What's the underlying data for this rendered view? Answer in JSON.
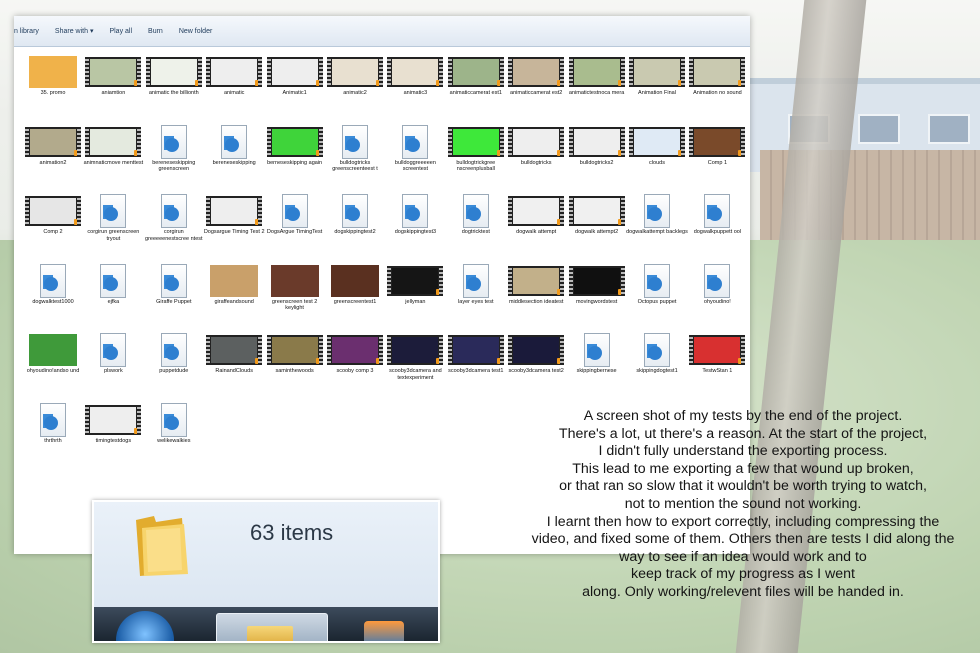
{
  "toolbar": {
    "library_label": "n library",
    "share_label": "Share with",
    "play_label": "Play all",
    "burn_label": "Burn",
    "new_folder_label": "New folder"
  },
  "files": [
    {
      "name": "35. promo",
      "kind": "picture",
      "tint": "#f0b24a"
    },
    {
      "name": "aniamtion",
      "kind": "video",
      "tint": "#b9c6a4"
    },
    {
      "name": "animatic the billionth",
      "kind": "video",
      "tint": "#eef2ea"
    },
    {
      "name": "animatic",
      "kind": "video",
      "tint": "#eeeeee"
    },
    {
      "name": "Animatic1",
      "kind": "video",
      "tint": "#eeeeee"
    },
    {
      "name": "animatic2",
      "kind": "video",
      "tint": "#e8e0d0"
    },
    {
      "name": "animatic3",
      "kind": "video",
      "tint": "#e8e0d0"
    },
    {
      "name": "animaticcamerat est1",
      "kind": "video",
      "tint": "#9db48a"
    },
    {
      "name": "animaticcamerat est2",
      "kind": "video",
      "tint": "#c7b59a"
    },
    {
      "name": "animatictestnoca mera",
      "kind": "video",
      "tint": "#a9bc8e"
    },
    {
      "name": "Animation Final",
      "kind": "video",
      "tint": "#c9c9b0"
    },
    {
      "name": "Animation no sound",
      "kind": "video",
      "tint": "#c9c9b0"
    },
    {
      "name": "animation2",
      "kind": "video",
      "tint": "#b2aa8c"
    },
    {
      "name": "animnaticmove menttest",
      "kind": "video",
      "tint": "#e4eadf"
    },
    {
      "name": "bereneseskipping greenscreen",
      "kind": "doc"
    },
    {
      "name": "bereneseskipping",
      "kind": "doc"
    },
    {
      "name": "berneseskipping again",
      "kind": "video",
      "tint": "#3fd43a"
    },
    {
      "name": "bulldogtricks greenscreenteest t",
      "kind": "doc"
    },
    {
      "name": "bulldoggreeeeen screentest",
      "kind": "doc"
    },
    {
      "name": "bulldogtrickgree nscreenplusball",
      "kind": "video",
      "tint": "#3ee83a"
    },
    {
      "name": "bulldogtricks",
      "kind": "video",
      "tint": "#eeeeee"
    },
    {
      "name": "bulldogtricks2",
      "kind": "video",
      "tint": "#eeeeee"
    },
    {
      "name": "clouds",
      "kind": "video",
      "tint": "#dfeaf5"
    },
    {
      "name": "Comp 1",
      "kind": "video",
      "tint": "#7a4a2a"
    },
    {
      "name": "Comp 2",
      "kind": "video",
      "tint": "#e6e6e6"
    },
    {
      "name": "corgirun greenscreen tryout",
      "kind": "doc"
    },
    {
      "name": "corgirun greeeeenestscree ntest",
      "kind": "doc"
    },
    {
      "name": "Dogsargue Timing Test 2",
      "kind": "video",
      "tint": "#eeeeee"
    },
    {
      "name": "DogsArgue TimingTest",
      "kind": "doc"
    },
    {
      "name": "dogskippingtest2",
      "kind": "doc"
    },
    {
      "name": "dogskippingtest3",
      "kind": "doc"
    },
    {
      "name": "dogtricktest",
      "kind": "doc"
    },
    {
      "name": "dogwalk attempt",
      "kind": "video",
      "tint": "#f0f0f0"
    },
    {
      "name": "dogwalk attempt2",
      "kind": "video",
      "tint": "#f0f0f0"
    },
    {
      "name": "dogwalkattempt backlegs",
      "kind": "doc"
    },
    {
      "name": "dogwalkpuppett ool",
      "kind": "doc"
    },
    {
      "name": "dogwalktest1000",
      "kind": "doc"
    },
    {
      "name": "ejfka",
      "kind": "doc"
    },
    {
      "name": "Giraffe Puppet",
      "kind": "doc"
    },
    {
      "name": "giraffeandsound",
      "kind": "picture",
      "tint": "#c9a06a"
    },
    {
      "name": "greenscreen test 2 keylight",
      "kind": "picture",
      "tint": "#6a3a2a"
    },
    {
      "name": "greenscreentest1",
      "kind": "picture",
      "tint": "#5a3020"
    },
    {
      "name": "jellyman",
      "kind": "video",
      "tint": "#151515"
    },
    {
      "name": "layer eyes test",
      "kind": "doc"
    },
    {
      "name": "middlesection ideatest",
      "kind": "video",
      "tint": "#c2b08a"
    },
    {
      "name": "movingwordstest",
      "kind": "video",
      "tint": "#101010"
    },
    {
      "name": "Octopus puppet",
      "kind": "doc"
    },
    {
      "name": "ohyoudino!",
      "kind": "doc"
    },
    {
      "name": "ohyoudino!andso und",
      "kind": "picture",
      "tint": "#3f9a3a"
    },
    {
      "name": "plswork",
      "kind": "doc"
    },
    {
      "name": "puppetdude",
      "kind": "doc"
    },
    {
      "name": "RainandClouds",
      "kind": "video",
      "tint": "#5c6060"
    },
    {
      "name": "saminthewoods",
      "kind": "video",
      "tint": "#8a7a4a"
    },
    {
      "name": "scooby comp 3",
      "kind": "video",
      "tint": "#6b2f6f"
    },
    {
      "name": "scooby3dcamera and textexperiment",
      "kind": "video",
      "tint": "#1c1c3a"
    },
    {
      "name": "scooby3dcamera test1",
      "kind": "video",
      "tint": "#2a2a5a"
    },
    {
      "name": "scooby3dcamera test2",
      "kind": "video",
      "tint": "#1a1a3a"
    },
    {
      "name": "skippingbernese",
      "kind": "doc"
    },
    {
      "name": "skippingdogtest1",
      "kind": "doc"
    },
    {
      "name": "TestwStan 1",
      "kind": "video",
      "tint": "#d83030"
    },
    {
      "name": "thrthrth",
      "kind": "doc"
    },
    {
      "name": "timingtestdogs",
      "kind": "video",
      "tint": "#eeeeee"
    },
    {
      "name": "welikewalkies",
      "kind": "doc"
    }
  ],
  "status": {
    "item_count": "63 items"
  },
  "caption": [
    "A screen shot of my tests by the end of the project.",
    "There's a lot,  ut there's a reason. At the start of the project,",
    "I didn't fully understand the exporting process.",
    "This lead to me exporting a few that wound up broken,",
    "or that ran so slow that it wouldn't be worth trying to watch,",
    "not to mention the sound not working.",
    "I learnt then how to export correctly, including compressing the",
    "video, and fixed some of them. Others then are tests I did along the",
    "way to see if an idea would work and to",
    "keep track of my progress as I went",
    "along. Only working/relevent files will be handed in."
  ]
}
